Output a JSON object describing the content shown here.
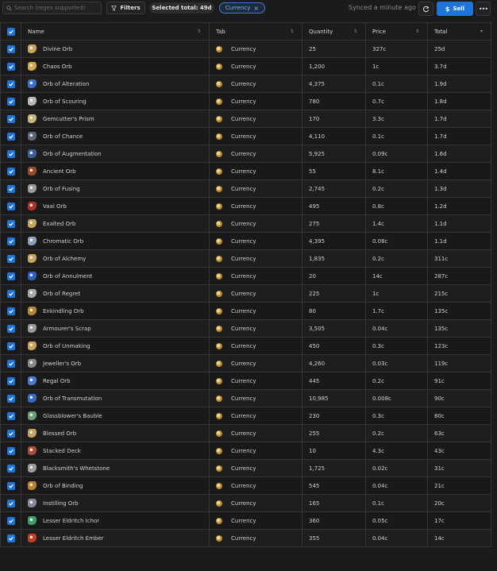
{
  "toolbar": {
    "search_placeholder": "Search (regex supported)",
    "filters_label": "Filters",
    "selected_total": "Selected total: 49d",
    "tag_label": "Currency",
    "synced_text": "Synced a minute ago",
    "sell_label": "Sell"
  },
  "colors": {
    "accent": "#1f74d9",
    "background": "#1b1b1b",
    "tab_icon": "#d4a94a"
  },
  "table": {
    "headers": {
      "name": "Name",
      "tab": "Tab",
      "quantity": "Quantity",
      "price": "Price",
      "total": "Total"
    },
    "rows": [
      {
        "name": "Divine Orb",
        "tab": "Currency",
        "quantity": "25",
        "price": "327c",
        "total": "25d",
        "icon": "divine-orb-icon",
        "color": "#c9a45a"
      },
      {
        "name": "Chaos Orb",
        "tab": "Currency",
        "quantity": "1,200",
        "price": "1c",
        "total": "3.7d",
        "icon": "chaos-orb-icon",
        "color": "#d4a94a"
      },
      {
        "name": "Orb of Alteration",
        "tab": "Currency",
        "quantity": "4,375",
        "price": "0.1c",
        "total": "1.9d",
        "icon": "orb-of-alteration-icon",
        "color": "#3d6fcf"
      },
      {
        "name": "Orb of Scouring",
        "tab": "Currency",
        "quantity": "780",
        "price": "0.7c",
        "total": "1.8d",
        "icon": "orb-of-scouring-icon",
        "color": "#b8b8b8"
      },
      {
        "name": "Gemcutter's Prism",
        "tab": "Currency",
        "quantity": "170",
        "price": "3.3c",
        "total": "1.7d",
        "icon": "gemcutters-prism-icon",
        "color": "#c8b37a"
      },
      {
        "name": "Orb of Chance",
        "tab": "Currency",
        "quantity": "4,110",
        "price": "0.1c",
        "total": "1.7d",
        "icon": "orb-of-chance-icon",
        "color": "#5a6a7a"
      },
      {
        "name": "Orb of Augmentation",
        "tab": "Currency",
        "quantity": "5,925",
        "price": "0.09c",
        "total": "1.6d",
        "icon": "orb-of-augmentation-icon",
        "color": "#3f5f9a"
      },
      {
        "name": "Ancient Orb",
        "tab": "Currency",
        "quantity": "55",
        "price": "8.1c",
        "total": "1.4d",
        "icon": "ancient-orb-icon",
        "color": "#9a4a2a"
      },
      {
        "name": "Orb of Fusing",
        "tab": "Currency",
        "quantity": "2,745",
        "price": "0.2c",
        "total": "1.3d",
        "icon": "orb-of-fusing-icon",
        "color": "#9a9a9a"
      },
      {
        "name": "Vaal Orb",
        "tab": "Currency",
        "quantity": "495",
        "price": "0.8c",
        "total": "1.2d",
        "icon": "vaal-orb-icon",
        "color": "#b0302a"
      },
      {
        "name": "Exalted Orb",
        "tab": "Currency",
        "quantity": "275",
        "price": "1.4c",
        "total": "1.1d",
        "icon": "exalted-orb-icon",
        "color": "#c9a45a"
      },
      {
        "name": "Chromatic Orb",
        "tab": "Currency",
        "quantity": "4,395",
        "price": "0.08c",
        "total": "1.1d",
        "icon": "chromatic-orb-icon",
        "color": "#8aa0b8"
      },
      {
        "name": "Orb of Alchemy",
        "tab": "Currency",
        "quantity": "1,835",
        "price": "0.2c",
        "total": "311c",
        "icon": "orb-of-alchemy-icon",
        "color": "#c9a45a"
      },
      {
        "name": "Orb of Annulment",
        "tab": "Currency",
        "quantity": "20",
        "price": "14c",
        "total": "287c",
        "icon": "orb-of-annulment-icon",
        "color": "#2f5fc0"
      },
      {
        "name": "Orb of Regret",
        "tab": "Currency",
        "quantity": "225",
        "price": "1c",
        "total": "215c",
        "icon": "orb-of-regret-icon",
        "color": "#a8a8a8"
      },
      {
        "name": "Enkindling Orb",
        "tab": "Currency",
        "quantity": "80",
        "price": "1.7c",
        "total": "135c",
        "icon": "enkindling-orb-icon",
        "color": "#b9862e"
      },
      {
        "name": "Armourer's Scrap",
        "tab": "Currency",
        "quantity": "3,505",
        "price": "0.04c",
        "total": "135c",
        "icon": "armourers-scrap-icon",
        "color": "#9a9a9a"
      },
      {
        "name": "Orb of Unmaking",
        "tab": "Currency",
        "quantity": "450",
        "price": "0.3c",
        "total": "123c",
        "icon": "orb-of-unmaking-icon",
        "color": "#c9a45a"
      },
      {
        "name": "Jeweller's Orb",
        "tab": "Currency",
        "quantity": "4,260",
        "price": "0.03c",
        "total": "119c",
        "icon": "jewellers-orb-icon",
        "color": "#8a8a8a"
      },
      {
        "name": "Regal Orb",
        "tab": "Currency",
        "quantity": "445",
        "price": "0.2c",
        "total": "91c",
        "icon": "regal-orb-icon",
        "color": "#4a7acf"
      },
      {
        "name": "Orb of Transmutation",
        "tab": "Currency",
        "quantity": "10,985",
        "price": "0.008c",
        "total": "90c",
        "icon": "orb-of-transmutation-icon",
        "color": "#3a6ac0"
      },
      {
        "name": "Glassblower's Bauble",
        "tab": "Currency",
        "quantity": "230",
        "price": "0.3c",
        "total": "80c",
        "icon": "glassblowers-bauble-icon",
        "color": "#6aa07a"
      },
      {
        "name": "Blessed Orb",
        "tab": "Currency",
        "quantity": "255",
        "price": "0.2c",
        "total": "63c",
        "icon": "blessed-orb-icon",
        "color": "#c9a45a"
      },
      {
        "name": "Stacked Deck",
        "tab": "Currency",
        "quantity": "10",
        "price": "4.3c",
        "total": "43c",
        "icon": "stacked-deck-icon",
        "color": "#b04a3a"
      },
      {
        "name": "Blacksmith's Whetstone",
        "tab": "Currency",
        "quantity": "1,725",
        "price": "0.02c",
        "total": "31c",
        "icon": "blacksmiths-whetstone-icon",
        "color": "#9a9a9a"
      },
      {
        "name": "Orb of Binding",
        "tab": "Currency",
        "quantity": "545",
        "price": "0.04c",
        "total": "21c",
        "icon": "orb-of-binding-icon",
        "color": "#b9862e"
      },
      {
        "name": "Instilling Orb",
        "tab": "Currency",
        "quantity": "165",
        "price": "0.1c",
        "total": "20c",
        "icon": "instilling-orb-icon",
        "color": "#8a8a9a"
      },
      {
        "name": "Lesser Eldritch Ichor",
        "tab": "Currency",
        "quantity": "360",
        "price": "0.05c",
        "total": "17c",
        "icon": "lesser-eldritch-ichor-icon",
        "color": "#3aa06a"
      },
      {
        "name": "Lesser Eldritch Ember",
        "tab": "Currency",
        "quantity": "355",
        "price": "0.04c",
        "total": "14c",
        "icon": "lesser-eldritch-ember-icon",
        "color": "#c0402a"
      }
    ]
  }
}
